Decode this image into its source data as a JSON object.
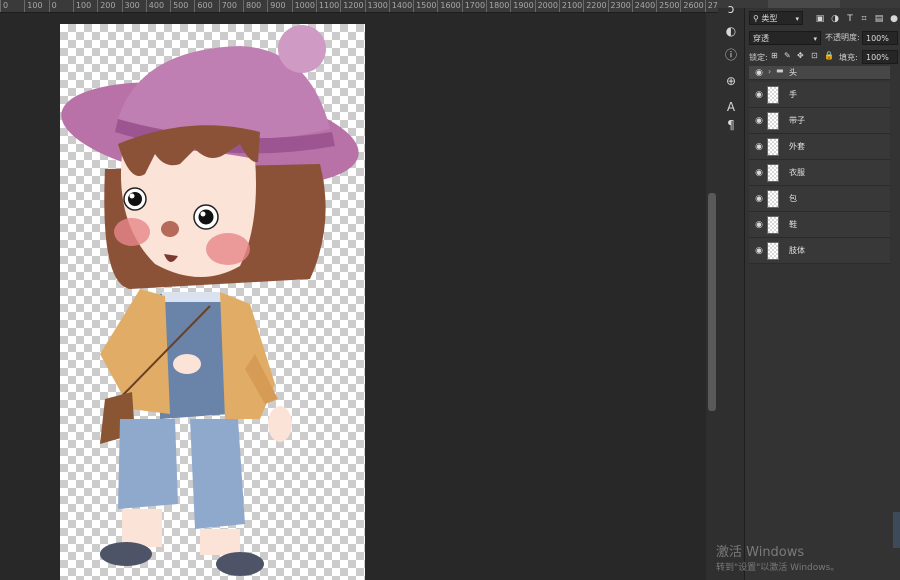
{
  "ruler": {
    "ticks": [
      "0",
      "100",
      "0",
      "100",
      "200",
      "300",
      "400",
      "500",
      "600",
      "700",
      "800",
      "900",
      "1000",
      "1100",
      "1200",
      "1300",
      "1400",
      "1500",
      "1600",
      "1700",
      "1800",
      "1900",
      "2000",
      "2100",
      "2200",
      "2300",
      "2400",
      "2500",
      "2600",
      "2700",
      "2800",
      "2900"
    ]
  },
  "properties_toolbar": {
    "icons": [
      "brush-settings-icon",
      "info-icon",
      "adjust-icon",
      "character-icon",
      "paragraph-icon"
    ]
  },
  "layers_panel": {
    "filter_label": "类型",
    "filter_icons": [
      "image-filter-icon",
      "adjustment-filter-icon",
      "type-filter-icon",
      "shape-filter-icon",
      "smart-object-filter-icon",
      "toggle-filter-icon"
    ],
    "blend_mode": "穿透",
    "opacity_label": "不透明度:",
    "opacity_value": "100%",
    "lock_label": "锁定:",
    "fill_label": "填充:",
    "fill_value": "100%",
    "layers": [
      {
        "name": "头",
        "type": "group",
        "visible": true
      },
      {
        "name": "手",
        "type": "layer",
        "visible": true
      },
      {
        "name": "带子",
        "type": "layer",
        "visible": true
      },
      {
        "name": "外套",
        "type": "layer",
        "visible": true
      },
      {
        "name": "衣服",
        "type": "layer",
        "visible": true
      },
      {
        "name": "包",
        "type": "layer",
        "visible": true
      },
      {
        "name": "鞋",
        "type": "layer",
        "visible": true
      },
      {
        "name": "肢体",
        "type": "layer",
        "visible": true
      }
    ]
  },
  "watermark": {
    "line1": "激活 Windows",
    "line2": "转到\"设置\"以激活 Windows。"
  },
  "colors": {
    "hat": "#b872a8",
    "hat_shadow": "#8f4f85",
    "hair": "#8b5237",
    "skin": "#fbe3d8",
    "cheek": "#e7868a",
    "jacket": "#e0ac66",
    "sweater": "#6a83a8",
    "pants": "#8fa9cc",
    "bag": "#8a5532",
    "shoes": "#4e5468"
  }
}
